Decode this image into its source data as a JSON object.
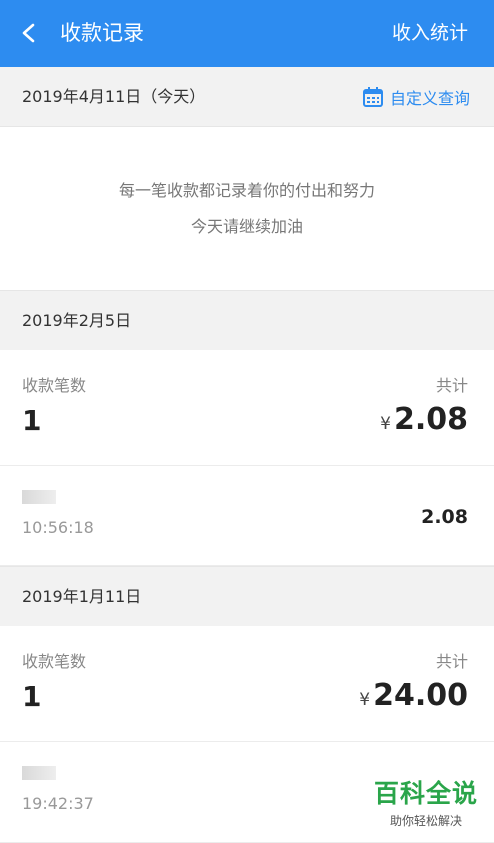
{
  "header": {
    "title": "收款记录",
    "stats_link": "收入统计"
  },
  "today": {
    "date": "2019年4月11日（今天）",
    "query_label": "自定义查询"
  },
  "empty": {
    "line1": "每一笔收款都记录着你的付出和努力",
    "line2": "今天请继续加油"
  },
  "groups": [
    {
      "date": "2019年2月5日",
      "count_label": "收款笔数",
      "count": "1",
      "total_label": "共计",
      "currency": "¥",
      "total": "2.08",
      "records": [
        {
          "time": "10:56:18",
          "amount": "2.08"
        }
      ]
    },
    {
      "date": "2019年1月11日",
      "count_label": "收款笔数",
      "count": "1",
      "total_label": "共计",
      "currency": "¥",
      "total": "24.00",
      "records": [
        {
          "time": "19:42:37",
          "amount": ""
        }
      ]
    }
  ],
  "watermark": {
    "main": "百科全说",
    "sub": "助你轻松解决"
  },
  "colors": {
    "primary": "#2d8cf0",
    "background": "#f2f2f2"
  },
  "icons": {
    "back": "chevron-left-icon",
    "calendar": "calendar-icon"
  }
}
